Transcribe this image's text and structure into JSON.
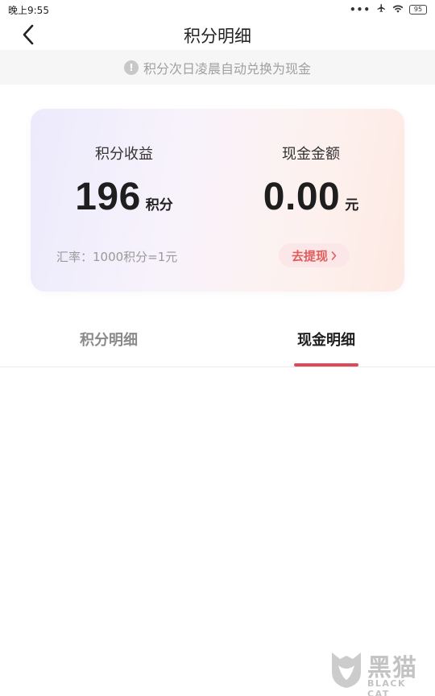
{
  "status_bar": {
    "time": "晚上9:55",
    "dots": "•••",
    "battery": "95",
    "icons": [
      "airplane-icon",
      "wifi-icon",
      "battery-icon"
    ]
  },
  "nav": {
    "title": "积分明细",
    "back_icon": "chevron-left-icon"
  },
  "notice": {
    "icon": "exclamation-icon",
    "text": "积分次日凌晨自动兑换为现金"
  },
  "card": {
    "points_label": "积分收益",
    "points_value": "196",
    "points_unit": "积分",
    "cash_label": "现金金额",
    "cash_value": "0.00",
    "cash_unit": "元",
    "rate_text": "汇率：1000积分=1元",
    "withdraw_label": "去提现",
    "accent_color": "#e25b5b"
  },
  "tabs": [
    {
      "label": "积分明细",
      "active": false
    },
    {
      "label": "现金明细",
      "active": true
    }
  ],
  "tab_indicator_color": "#e04757",
  "watermark": {
    "cn": "黑猫",
    "en": "BLACK CAT"
  }
}
